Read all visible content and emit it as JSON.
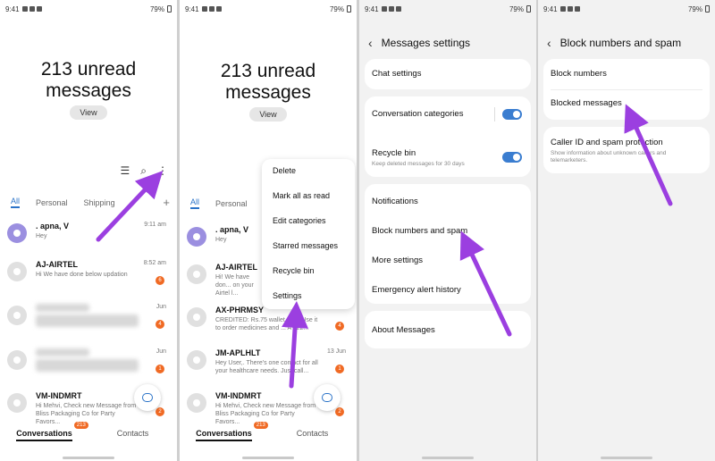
{
  "status": {
    "time": "9:41",
    "battery": "79%"
  },
  "panel1": {
    "unread_line1": "213 unread",
    "unread_line2": "messages",
    "view_label": "View",
    "tabs": [
      "All",
      "Personal",
      "Shipping"
    ],
    "conversations": [
      {
        "name": ". apna, V",
        "snippet": "Hey",
        "time": "9:11 am",
        "badge": ""
      },
      {
        "name": "AJ-AIRTEL",
        "snippet": "Hi We have done below updation",
        "time": "8:52 am",
        "badge": "6"
      },
      {
        "name": "",
        "snippet": "",
        "time": "Jun",
        "badge": "4"
      },
      {
        "name": "",
        "snippet": "",
        "time": "Jun",
        "badge": "1"
      },
      {
        "name": "VM-INDMRT",
        "snippet": "Hi Mehvi, Check new Message from Bliss Packaging Co for Party Favors...",
        "time": "",
        "badge": "2"
      }
    ],
    "nav": {
      "conversations": "Conversations",
      "count": "213",
      "contacts": "Contacts"
    }
  },
  "panel2": {
    "unread_line1": "213 unread",
    "unread_line2": "messages",
    "view_label": "View",
    "tabs": [
      "All",
      "Personal"
    ],
    "menu": [
      "Delete",
      "Mark all as read",
      "Edit categories",
      "Starred messages",
      "Recycle bin",
      "Settings"
    ],
    "conversations": [
      {
        "name": ". apna, V",
        "snippet": "Hey",
        "time": "",
        "badge": ""
      },
      {
        "name": "AJ-AIRTEL",
        "snippet": "Hi! We have don... on your Airtel l...",
        "time": "",
        "badge": ""
      },
      {
        "name": "AX-PHRMSY",
        "snippet": "CREDITED: Rs.75 wallet ...ay. Use it to order medicines and ... AT 22...",
        "time": "",
        "badge": "4"
      },
      {
        "name": "JM-APLHLT",
        "snippet": "Hey User,. There's one contact for all your healthcare needs. Just call...",
        "time": "13 Jun",
        "badge": "1"
      },
      {
        "name": "VM-INDMRT",
        "snippet": "Hi Mehvi, Check new Message from Bliss Packaging Co for Party Favors...",
        "time": "",
        "badge": "2"
      }
    ],
    "nav": {
      "conversations": "Conversations",
      "count": "213",
      "contacts": "Contacts"
    }
  },
  "panel3": {
    "title": "Messages settings",
    "chat_settings": "Chat settings",
    "conversation_categories": "Conversation categories",
    "recycle_bin": "Recycle bin",
    "recycle_bin_sub": "Keep deleted messages for 30 days",
    "notifications": "Notifications",
    "block_numbers_spam": "Block numbers and spam",
    "more_settings": "More settings",
    "emergency_alert": "Emergency alert history",
    "about": "About Messages"
  },
  "panel4": {
    "title": "Block numbers and spam",
    "block_numbers": "Block numbers",
    "blocked_messages": "Blocked messages",
    "caller_id": "Caller ID and spam protection",
    "caller_id_sub": "Show information about unknown callers and telemarketers."
  },
  "colors": {
    "accent": "#2b73c8",
    "badge": "#f06a24",
    "arrow": "#9b3fe0",
    "toggle": "#3a7dd0"
  }
}
